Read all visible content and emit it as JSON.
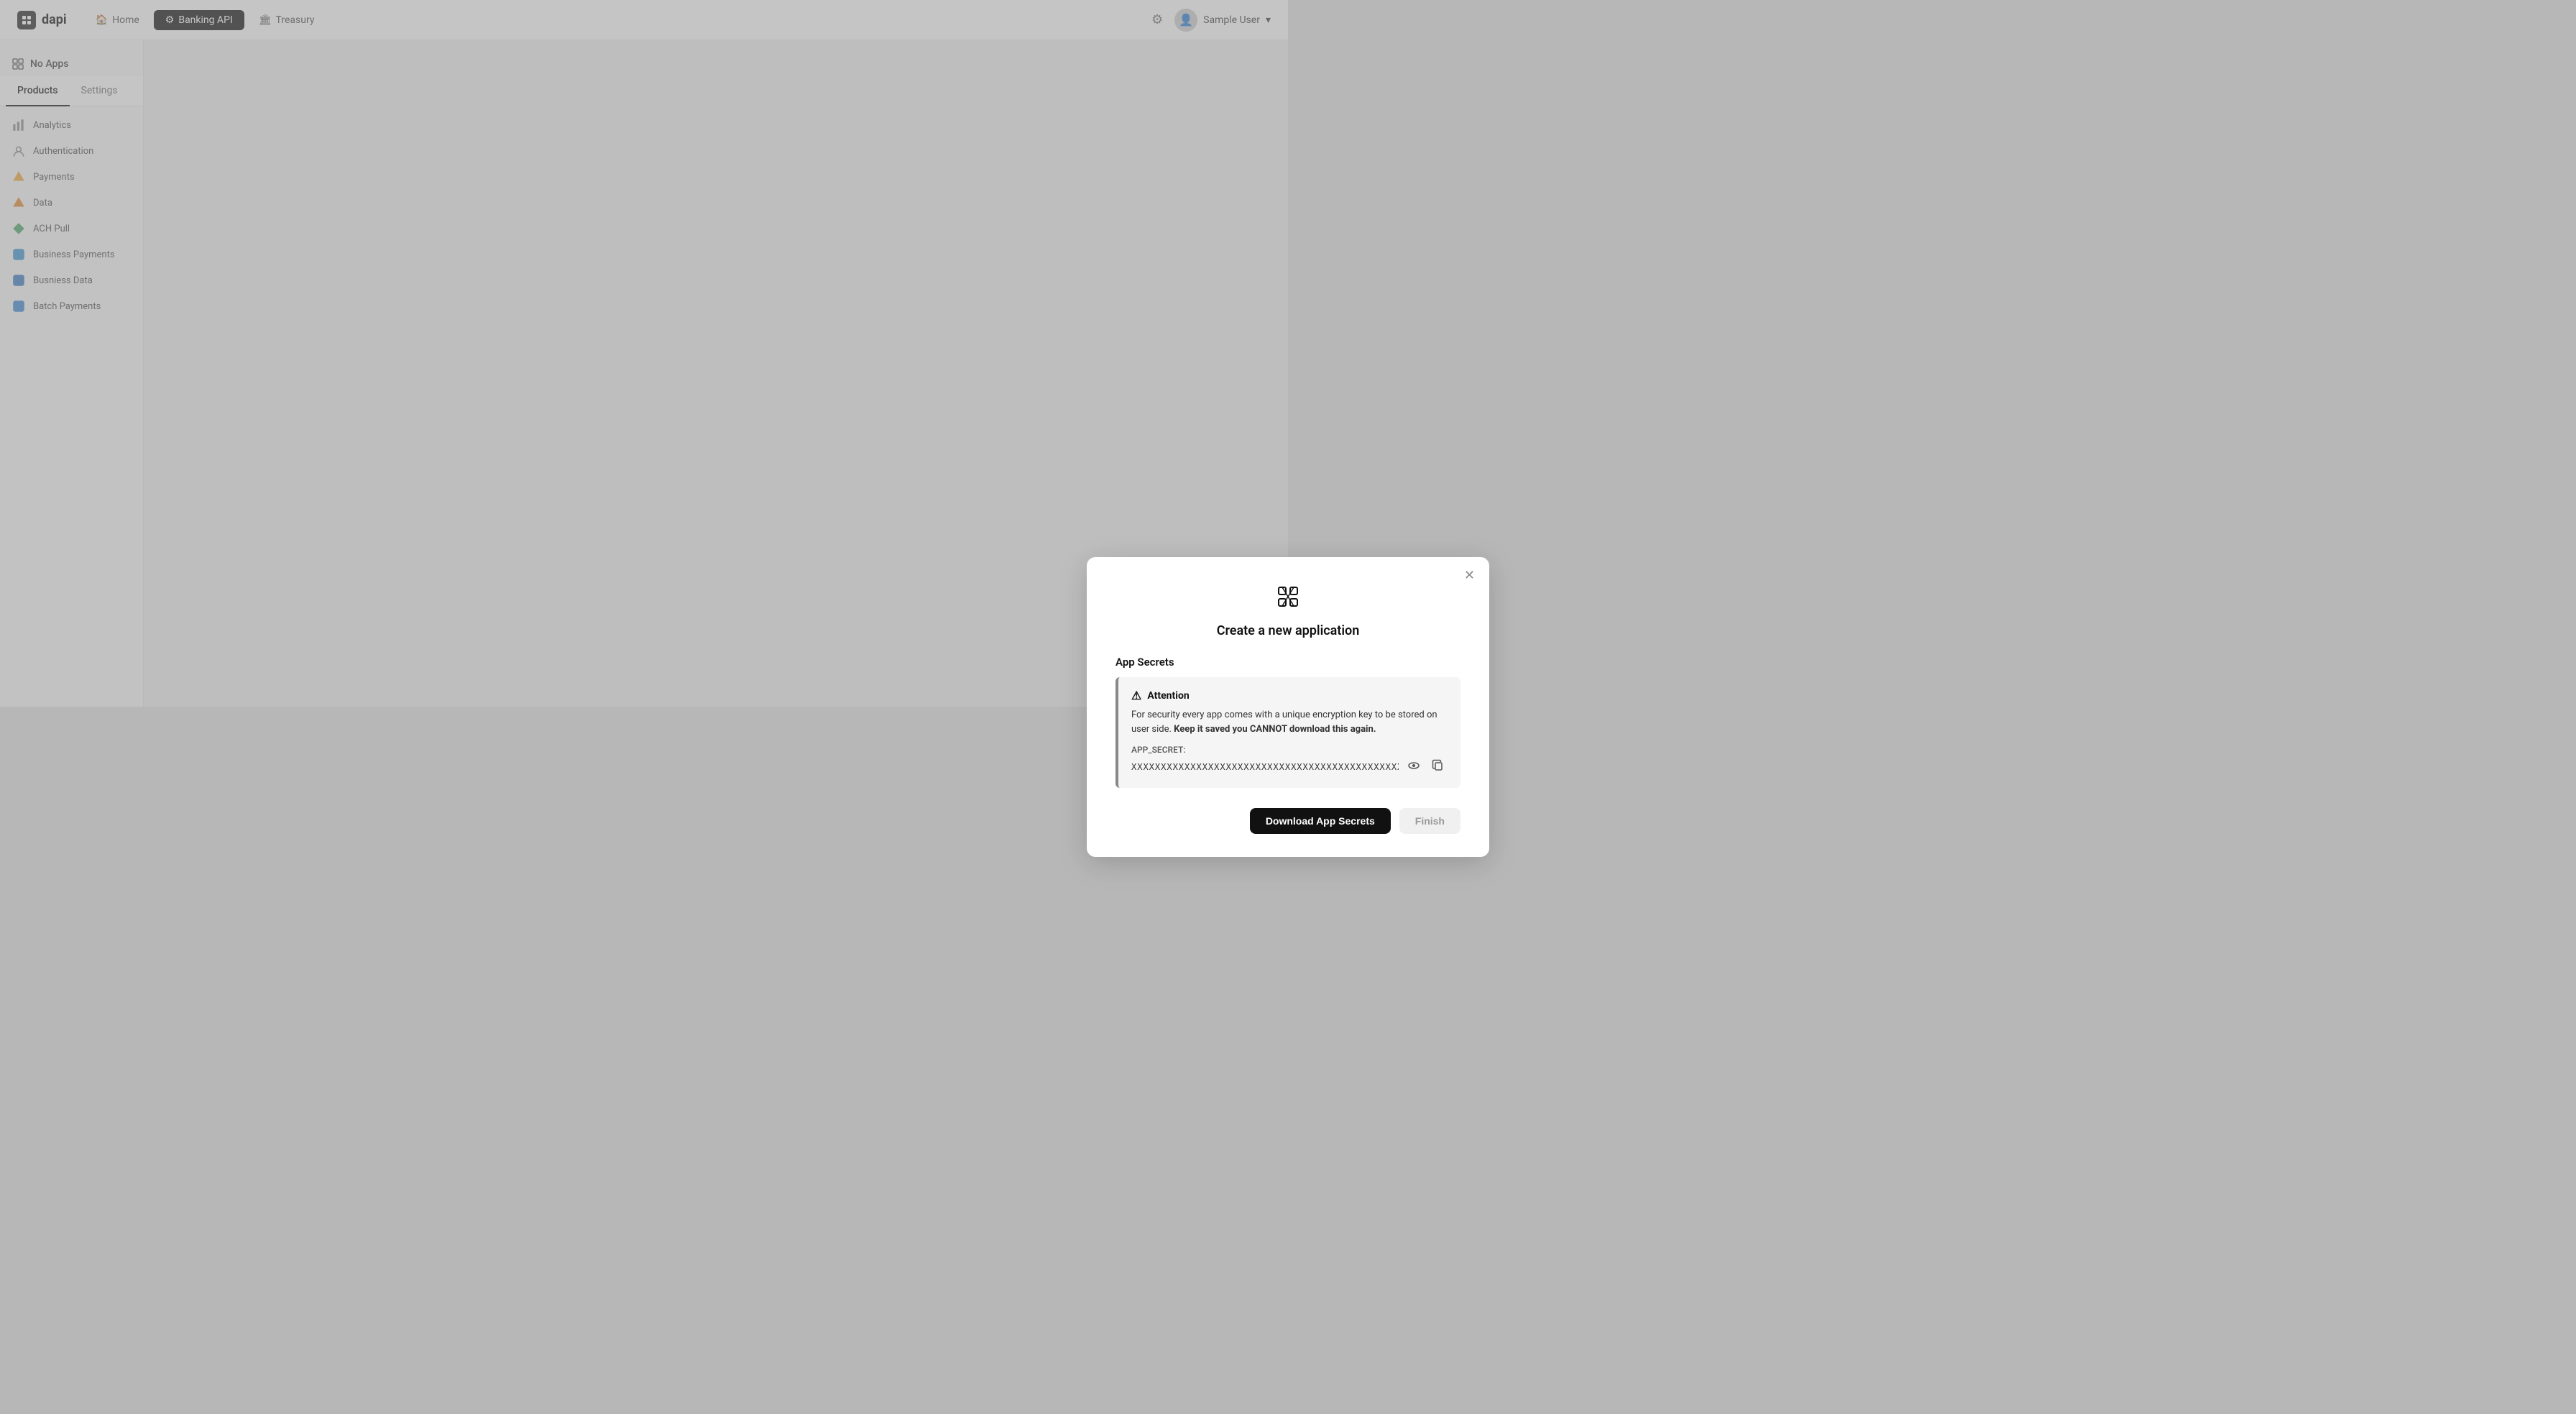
{
  "header": {
    "logo_text": "dapi",
    "nav_items": [
      {
        "label": "Home",
        "icon": "🏠",
        "active": false
      },
      {
        "label": "Banking API",
        "icon": "⚙",
        "active": true
      },
      {
        "label": "Treasury",
        "icon": "🏛",
        "active": false
      }
    ],
    "settings_label": "Settings",
    "user_name": "Sample User"
  },
  "sidebar": {
    "no_apps_label": "No Apps",
    "tabs": [
      {
        "label": "Products",
        "active": true
      },
      {
        "label": "Settings",
        "active": false
      }
    ],
    "items": [
      {
        "label": "Analytics",
        "icon": "analytics"
      },
      {
        "label": "Authentication",
        "icon": "auth"
      },
      {
        "label": "Payments",
        "icon": "payments"
      },
      {
        "label": "Data",
        "icon": "data"
      },
      {
        "label": "ACH Pull",
        "icon": "ach"
      },
      {
        "label": "Business Payments",
        "icon": "business"
      },
      {
        "label": "Busniess Data",
        "icon": "business-data"
      },
      {
        "label": "Batch Payments",
        "icon": "batch"
      }
    ]
  },
  "modal": {
    "title": "Create a new application",
    "app_secrets_heading": "App Secrets",
    "attention_heading": "Attention",
    "attention_body": "For security every app comes with a unique encryption key to be stored on user side.",
    "attention_bold": "Keep it saved you CANNOT download this again.",
    "secret_label": "APP_SECRET:",
    "secret_value": "XXXXXXXXXXXXXXXXXXXXXXXXXXXXXXXXXXXXXXXXXXXXXXXXXX",
    "download_btn": "Download App Secrets",
    "finish_btn": "Finish"
  }
}
